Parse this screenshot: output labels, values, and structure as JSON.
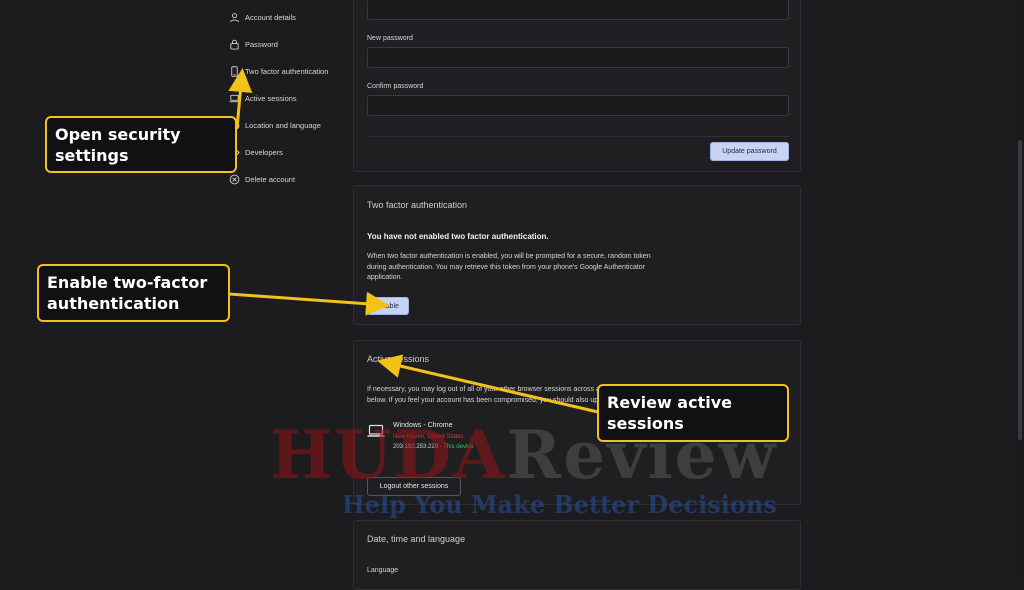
{
  "sidebar": {
    "items": [
      {
        "label": "Account details",
        "icon": "user-icon"
      },
      {
        "label": "Password",
        "icon": "lock-icon"
      },
      {
        "label": "Two factor authentication",
        "icon": "phone-icon"
      },
      {
        "label": "Active sessions",
        "icon": "laptop-icon"
      },
      {
        "label": "Location and language",
        "icon": "globe-icon"
      },
      {
        "label": "Developers",
        "icon": "code-icon"
      },
      {
        "label": "Delete account",
        "icon": "circle-x-icon"
      }
    ]
  },
  "password_card": {
    "new_password_label": "New password",
    "confirm_password_label": "Confirm password",
    "update_button": "Update password"
  },
  "two_factor_card": {
    "title": "Two factor authentication",
    "status": "You have not enabled two factor authentication.",
    "description_lines": [
      "When two factor authentication is enabled, you will be prompted for a secure, random token",
      "during authentication. You may retrieve this token from your phone's Google Authenticator",
      "application."
    ],
    "enable_button": "Enable"
  },
  "sessions_card": {
    "title": "Active sessions",
    "description_lines": [
      "If necessary, you may log out of all of your other browser sessions across all of your devices",
      "below. If you feel your account has been compromised, you should also update your password."
    ],
    "session": {
      "device": "Windows - Chrome",
      "location": "New Haven, United States",
      "ip": "203.192.253.229",
      "separator": " - ",
      "this_device": "This device"
    },
    "logout_button": "Logout other sessions"
  },
  "language_card": {
    "title": "Date, time and language",
    "language_label": "Language"
  },
  "callouts": {
    "security": "Open security settings",
    "two_factor": "Enable two-factor authentication",
    "sessions": "Review active sessions"
  },
  "watermark": {
    "main_a": "HUDA",
    "main_b": "Review",
    "sub": "Help You Make Better Decisions"
  },
  "colors": {
    "accent": "#f2c21b",
    "primary_button": "#c7d3f2",
    "background": "#1c1c1e",
    "this_device": "#3fc15a",
    "location": "#cc3b3b"
  }
}
